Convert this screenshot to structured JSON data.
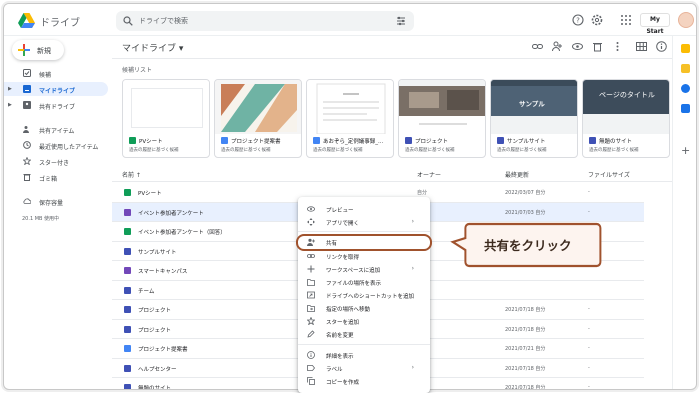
{
  "app": {
    "title": "ドライブ",
    "search_placeholder": "ドライブで検索",
    "mystart_label": "My Start"
  },
  "colors": {
    "accent_blue": "#1a73e8",
    "selected_row": "#e8f0fe",
    "highlight": "#a0522d",
    "callout_fill": "#fdf4ef"
  },
  "sidebar": {
    "new_label": "新規",
    "items": [
      {
        "label": "候補",
        "icon": "check-square-icon"
      },
      {
        "label": "マイドライブ",
        "icon": "drive-icon",
        "active": true
      },
      {
        "label": "共有ドライブ",
        "icon": "shared-drive-icon"
      },
      {
        "label": "共有アイテム",
        "icon": "people-icon"
      },
      {
        "label": "最近使用したアイテム",
        "icon": "clock-icon"
      },
      {
        "label": "スター付き",
        "icon": "star-icon"
      },
      {
        "label": "ゴミ箱",
        "icon": "trash-icon"
      },
      {
        "label": "保存容量",
        "icon": "cloud-icon"
      }
    ],
    "storage_text": "20.1 MB 使用中"
  },
  "main": {
    "breadcrumb": "マイドライブ ▾",
    "section_label": "候補リスト",
    "cards": [
      {
        "name": "PVシート",
        "sub": "過去の履歴に基づく候補",
        "type": "sheet"
      },
      {
        "name": "プロジェクト提案書",
        "sub": "過去の履歴に基づく候補",
        "type": "doc"
      },
      {
        "name": "あおぞら_定例議事録_...",
        "sub": "過去の履歴に基づく候補",
        "type": "doc"
      },
      {
        "name": "プロジェクト",
        "sub": "過去の履歴に基づく候補",
        "type": "site"
      },
      {
        "name": "サンプルサイト",
        "sub": "過去の履歴に基づく候補",
        "type": "site",
        "thumb_text": "サンプル"
      },
      {
        "name": "無題のサイト",
        "sub": "過去の履歴に基づく候補",
        "type": "site",
        "thumb_text": "ページのタイトル"
      }
    ],
    "columns": {
      "name": "名前 ↑",
      "owner": "オーナー",
      "modified": "最終更新",
      "size": "ファイルサイズ"
    },
    "rows": [
      {
        "name": "PVシート",
        "owner": "自分",
        "date": "2022/03/07 自分",
        "size": "-",
        "type": "sheet"
      },
      {
        "name": "イベント参加者アンケート",
        "owner": "",
        "date": "2021/07/03 自分",
        "size": "-",
        "type": "form"
      },
      {
        "name": "イベント参加者アンケート（回答）",
        "owner": "",
        "date": "2021/07/03 自分",
        "size": "-",
        "type": "sheet"
      },
      {
        "name": "サンプルサイト",
        "owner": "",
        "date": "",
        "size": "",
        "type": "site"
      },
      {
        "name": "スマートキャンパス",
        "owner": "",
        "date": "",
        "size": "",
        "type": "form"
      },
      {
        "name": "チーム",
        "owner": "",
        "date": "",
        "size": "",
        "type": "site"
      },
      {
        "name": "プロジェクト",
        "owner": "",
        "date": "2021/07/18 自分",
        "size": "-",
        "type": "site"
      },
      {
        "name": "プロジェクト",
        "owner": "",
        "date": "2021/07/18 自分",
        "size": "-",
        "type": "site"
      },
      {
        "name": "プロジェクト提案書",
        "owner": "",
        "date": "2021/07/21 自分",
        "size": "-",
        "type": "doc"
      },
      {
        "name": "ヘルプセンター",
        "owner": "",
        "date": "2021/07/18 自分",
        "size": "-",
        "type": "site"
      },
      {
        "name": "無題のサイト",
        "owner": "",
        "date": "2021/07/18 自分",
        "size": "-",
        "type": "site"
      }
    ]
  },
  "menu": {
    "items": [
      {
        "label": "プレビュー",
        "icon": "eye-icon"
      },
      {
        "label": "アプリで開く",
        "icon": "move-icon",
        "sub": "›"
      },
      {
        "label": "共有",
        "icon": "person-add-icon"
      },
      {
        "label": "リンクを取得",
        "icon": "link-icon"
      },
      {
        "label": "ワークスペースに追加",
        "icon": "plus-icon",
        "sub": "›"
      },
      {
        "label": "ファイルの場所を表示",
        "icon": "folder-icon"
      },
      {
        "label": "ドライブへのショートカットを追加",
        "icon": "shortcut-icon"
      },
      {
        "label": "指定の場所へ移動",
        "icon": "move-folder-icon"
      },
      {
        "label": "スターを追加",
        "icon": "star-icon"
      },
      {
        "label": "名前を変更",
        "icon": "pencil-icon"
      },
      {
        "label": "詳細を表示",
        "icon": "info-icon"
      },
      {
        "label": "ラベル",
        "icon": "label-icon",
        "sub": "›"
      },
      {
        "label": "コピーを作成",
        "icon": "copy-icon"
      }
    ]
  },
  "callout": {
    "text": "共有をクリック"
  }
}
